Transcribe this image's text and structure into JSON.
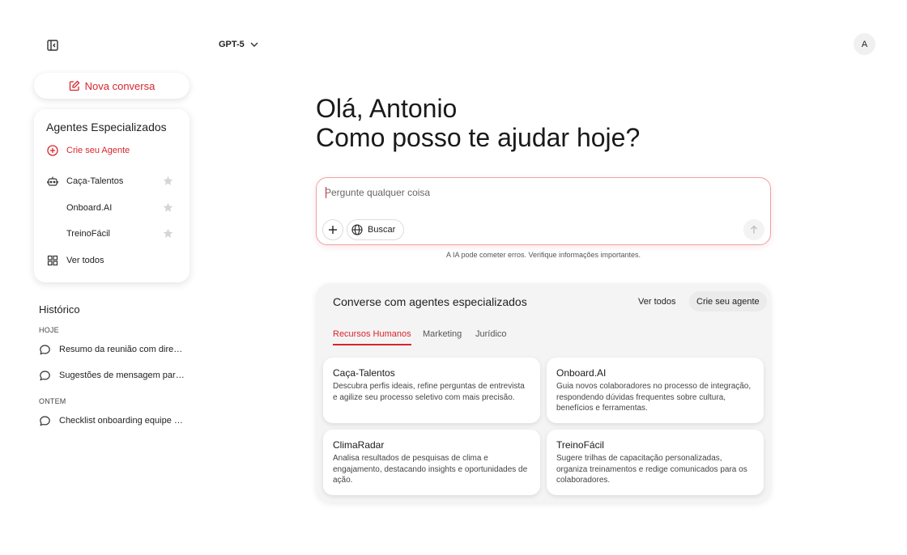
{
  "header": {
    "model": "GPT-5",
    "avatar_initial": "A"
  },
  "sidebar": {
    "new_chat_label": "Nova conversa",
    "agents_title": "Agentes Especializados",
    "create_agent_label": "Crie seu Agente",
    "agents": [
      {
        "label": "Caça-Talentos",
        "icon": "robot-icon"
      },
      {
        "label": "Onboard.AI",
        "icon": ""
      },
      {
        "label": "TreinoFácil",
        "icon": ""
      }
    ],
    "see_all_label": "Ver todos",
    "history_title": "Histórico",
    "history_groups": [
      {
        "label": "HOJE",
        "items": [
          "Resumo da reunião com diretoria",
          "Sugestões de mensagem para equipe"
        ]
      },
      {
        "label": "ONTEM",
        "items": [
          "Checklist onboarding equipe comercial"
        ]
      }
    ]
  },
  "main": {
    "greeting_line1": "Olá, Antonio",
    "greeting_line2": "Como posso te ajudar hoje?",
    "prompt": {
      "placeholder": "Pergunte qualquer coisa",
      "value": "",
      "search_label": "Buscar"
    },
    "disclaimer": "A IA pode cometer erros. Verifique informações importantes.",
    "agents_panel": {
      "title": "Converse com agentes especializados",
      "see_all_label": "Ver todos",
      "create_label": "Crie seu agente",
      "tabs": [
        {
          "label": "Recursos Humanos",
          "active": true
        },
        {
          "label": "Marketing",
          "active": false
        },
        {
          "label": "Jurídico",
          "active": false
        }
      ],
      "cards": [
        {
          "name": "Caça-Talentos",
          "description": "Descubra perfis ideais, refine perguntas de entrevista e agilize seu processo seletivo com mais precisão."
        },
        {
          "name": "Onboard.AI",
          "description": "Guia novos colaboradores no processo de integração, respondendo dúvidas frequentes sobre cultura, benefícios e ferramentas."
        },
        {
          "name": "ClimaRadar",
          "description": "Analisa resultados de pesquisas de clima e engajamento, destacando insights e oportunidades de ação."
        },
        {
          "name": "TreinoFácil",
          "description": "Sugere trilhas de capacitação personalizadas, organiza treinamentos e redige comunicados para os colaboradores."
        }
      ]
    }
  },
  "colors": {
    "accent": "#d7262e",
    "panel_bg": "#f4f4f4"
  }
}
